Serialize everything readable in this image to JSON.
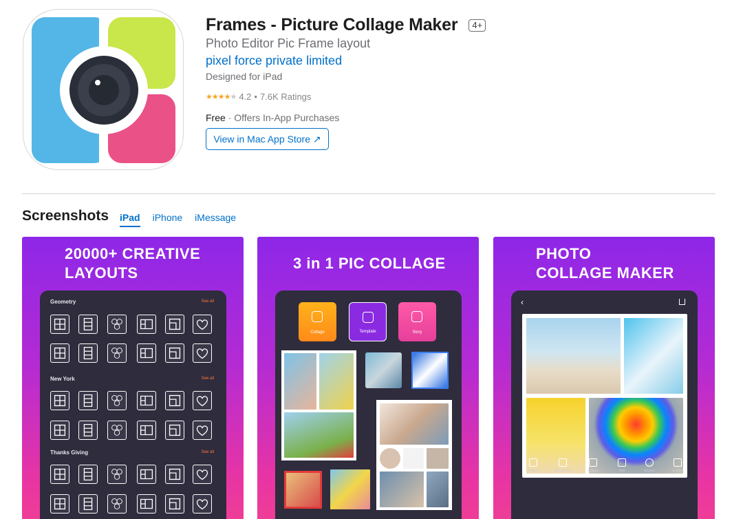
{
  "app": {
    "title": "Frames - Picture Collage Maker",
    "age_rating": "4+",
    "subtitle": "Photo Editor Pic Frame layout",
    "developer": "pixel force private limited",
    "designed_for": "Designed for iPad",
    "rating": "4.2",
    "rating_stars": 4.2,
    "ratings_count": "7.6K Ratings",
    "price": "Free",
    "iap": "Offers In-App Purchases",
    "mac_store_button": "View in Mac App Store ↗"
  },
  "colors": {
    "accent": "#0070c9",
    "star": "#f5a623",
    "shot_gradient_top": "#8e27e8",
    "shot_gradient_bottom": "#ef3f95",
    "device_bg": "#2f2c3d",
    "icon_blue": "#53b6e6",
    "icon_lime": "#c9e64a",
    "icon_pink": "#ea5186",
    "icon_camera": "#3a3f4b"
  },
  "screenshots": {
    "heading": "Screenshots",
    "tabs": [
      {
        "label": "iPad",
        "active": true
      },
      {
        "label": "iPhone",
        "active": false
      },
      {
        "label": "iMessage",
        "active": false
      }
    ],
    "items": [
      {
        "heading_lines": [
          "20000+ CREATIVE",
          "LAYOUTS"
        ],
        "groups": [
          {
            "title": "Geometry",
            "see_all": "See all"
          },
          {
            "title": "New York",
            "see_all": "See all"
          },
          {
            "title": "Thanks Giving",
            "see_all": "See all"
          }
        ]
      },
      {
        "heading_lines": [
          "3 in 1 PIC COLLAGE"
        ],
        "modes": [
          "Collage",
          "Template",
          "Story"
        ]
      },
      {
        "heading_lines": [
          "PHOTO",
          "COLLAGE MAKER"
        ],
        "toolbar": [
          "Frames",
          "Background",
          "Settings",
          "Text",
          "Stickers",
          "Borders"
        ]
      }
    ]
  }
}
